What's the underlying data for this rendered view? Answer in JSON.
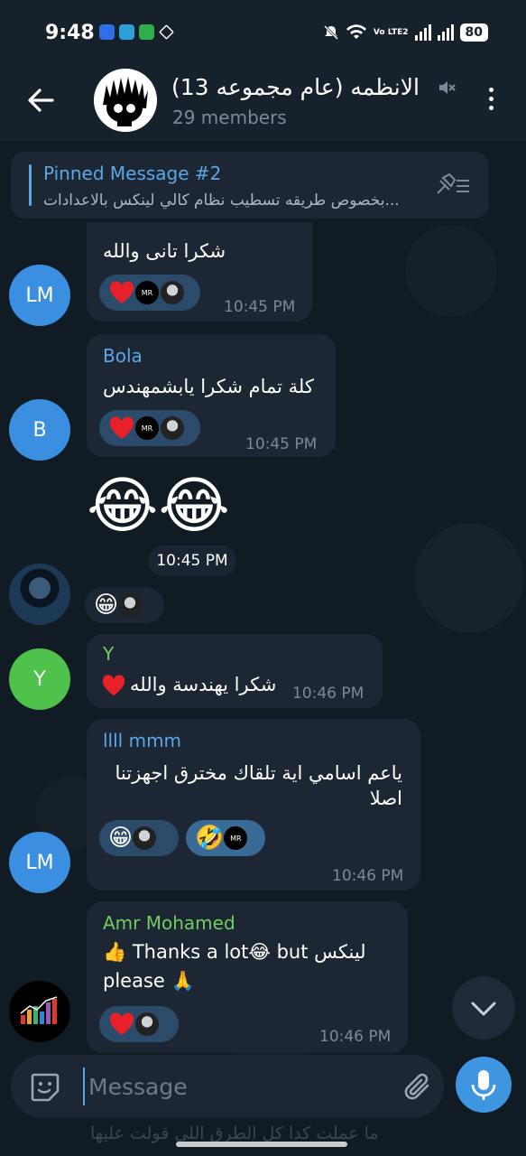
{
  "status": {
    "time": "9:48",
    "battery": "80",
    "volte": "Vo LTE2"
  },
  "header": {
    "title": "(13 الانظمه (عام مجموعه",
    "subtitle": "29 members"
  },
  "pinned": {
    "title": "Pinned Message #2",
    "text": "بخصوص طريقه تسطيب نظام كالي لينكس بالاعدادات..."
  },
  "messages": [
    {
      "sender": "",
      "text": "شكرا تانى والله",
      "time": "10:45 PM",
      "avatar": "LM",
      "avatar_color": "#3b8fe0"
    },
    {
      "sender": "Bola",
      "sender_color": "#5aa7e8",
      "text": "كلة تمام  شكرا يابشمهندس",
      "time": "10:45 PM",
      "avatar": "B",
      "avatar_color": "#3b8fe0"
    },
    {
      "sender": "",
      "emoji": "😂😂",
      "time": "10:45 PM"
    },
    {
      "sender": "Y",
      "sender_color": "#6fce5d",
      "text": "شكرا يهندسة والله",
      "time": "10:46 PM",
      "avatar": "Y",
      "avatar_color": "#4ec24b"
    },
    {
      "sender": "llll mmm",
      "sender_color": "#5aa7e8",
      "text_line1": "ياعم اسامي اية تلقاك مخترق اجهزتنا",
      "text_line2": "اصلا",
      "time": "10:46 PM",
      "avatar": "LM",
      "avatar_color": "#3b8fe0"
    },
    {
      "sender": "Amr Mohamed",
      "sender_color": "#6fce5d",
      "text_line1": "👍 Thanks a lot😂 but لينكس",
      "text_line2": "please 🙏",
      "time": "10:46 PM"
    }
  ],
  "composer": {
    "placeholder": "Message",
    "ghost": "ما عملت كدا كل الطرق اللي قولت عليها"
  },
  "colors": {
    "accent": "#5aa7e8",
    "bubble": "#1c2733",
    "reaction": "#2b4b6a"
  }
}
